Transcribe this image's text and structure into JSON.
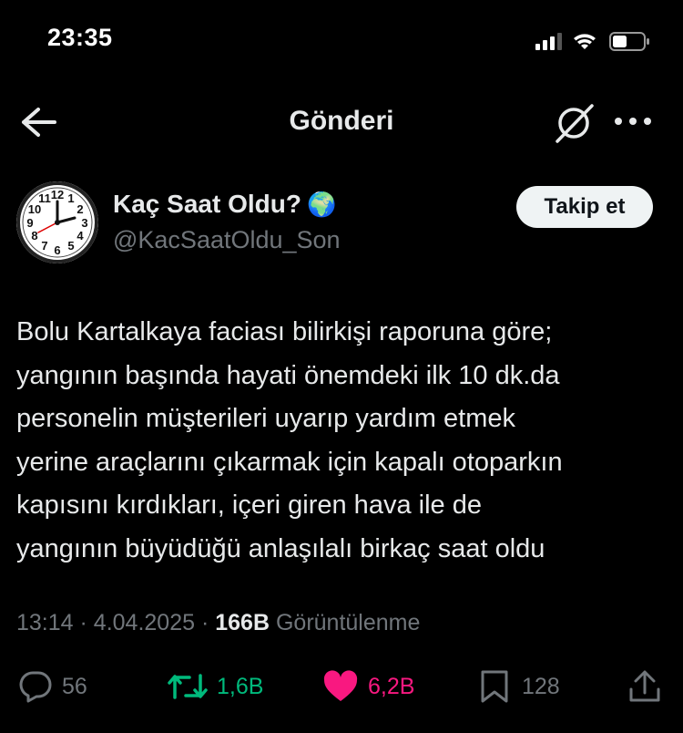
{
  "status_bar": {
    "time": "23:35"
  },
  "nav": {
    "title": "Gönderi"
  },
  "author": {
    "name": "Kaç Saat Oldu?",
    "emoji": "🌍",
    "handle": "@KacSaatOldu_Son",
    "avatar_icon": "clock-icon"
  },
  "follow_label": "Takip et",
  "tweet": {
    "text": "Bolu Kartalkaya faciası bilirkişi raporuna göre;\nyangının başında hayati önemdeki ilk 10 dk.da\npersonelin müşterileri uyarıp yardım etmek\nyerine araçlarını çıkarmak için kapalı otoparkın\nkapısını kırdıkları, içeri giren hava ile de\nyangının büyüdüğü anlaşılalı birkaç saat oldu"
  },
  "meta": {
    "time": "13:14",
    "date": "4.04.2025",
    "views": "166B",
    "views_label": "Görüntülenme",
    "separator": "·"
  },
  "actions": {
    "replies": "56",
    "reposts": "1,6B",
    "likes": "6,2B",
    "bookmarks": "128"
  },
  "colors": {
    "background": "#000000",
    "text": "#e7e9ea",
    "muted": "#71767b",
    "repost": "#00ba7c",
    "like": "#f91880"
  }
}
